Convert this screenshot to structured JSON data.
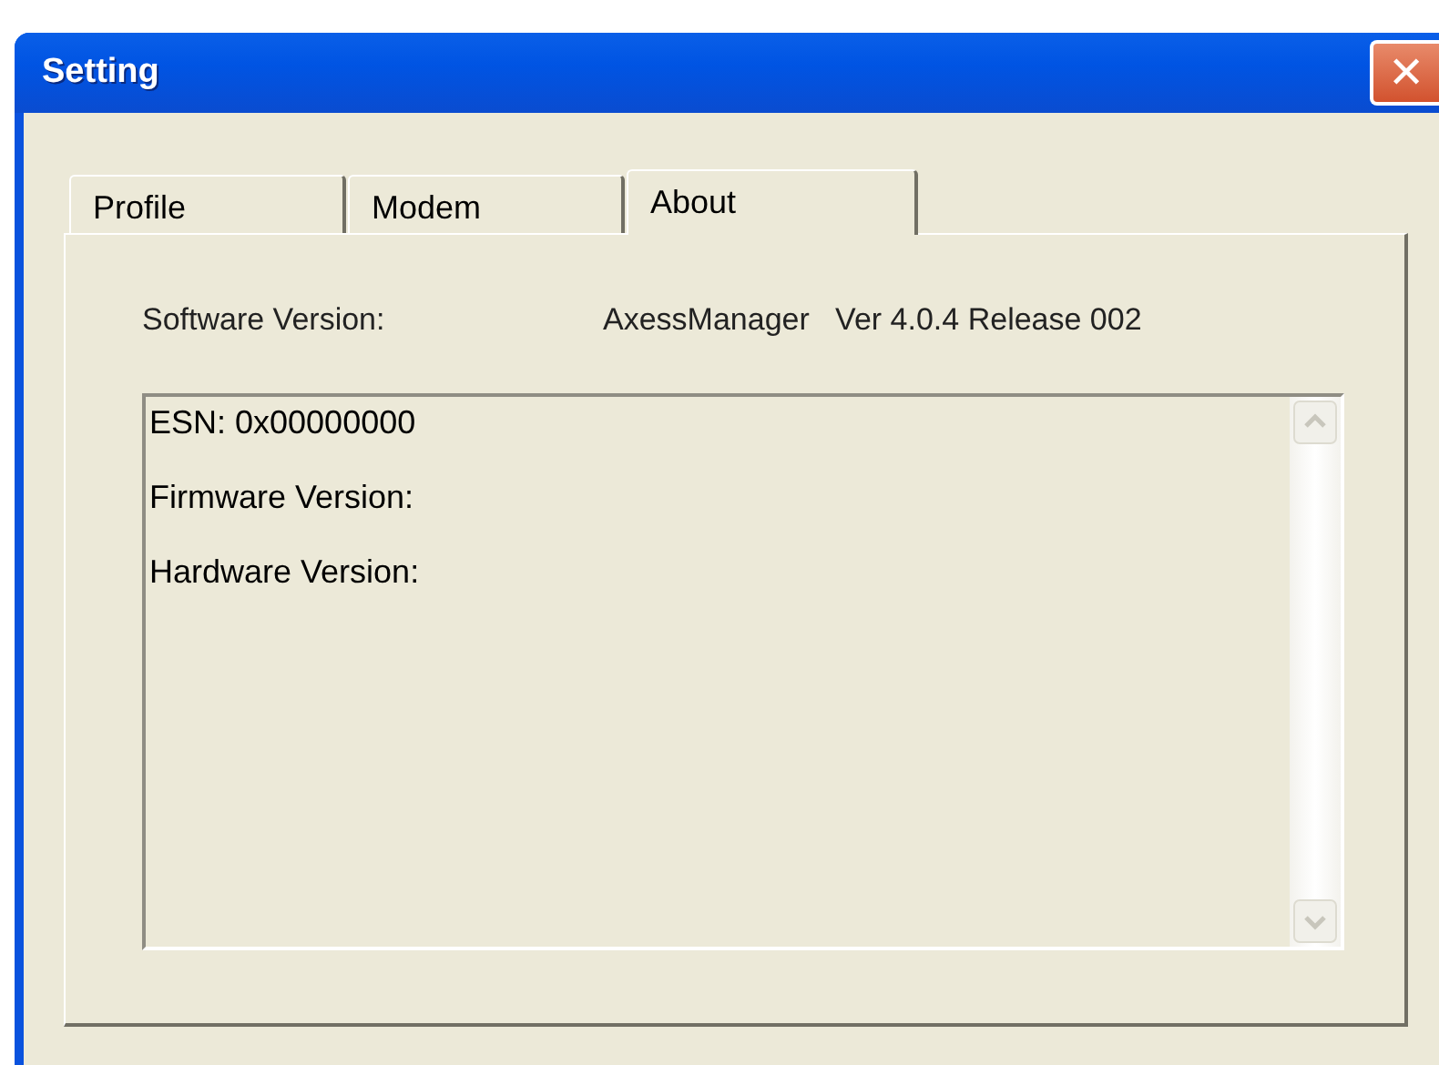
{
  "window": {
    "title": "Setting",
    "close": "✕"
  },
  "tabs": [
    {
      "label": "Profile",
      "selected": false
    },
    {
      "label": "Modem",
      "selected": false
    },
    {
      "label": "About",
      "selected": true
    }
  ],
  "software_version": {
    "label": "Software Version:",
    "value": "AxessManager   Ver 4.0.4 Release 002"
  },
  "info_box": {
    "lines": [
      "ESN: 0x00000000",
      "Firmware Version:",
      "Hardware Version:"
    ]
  }
}
